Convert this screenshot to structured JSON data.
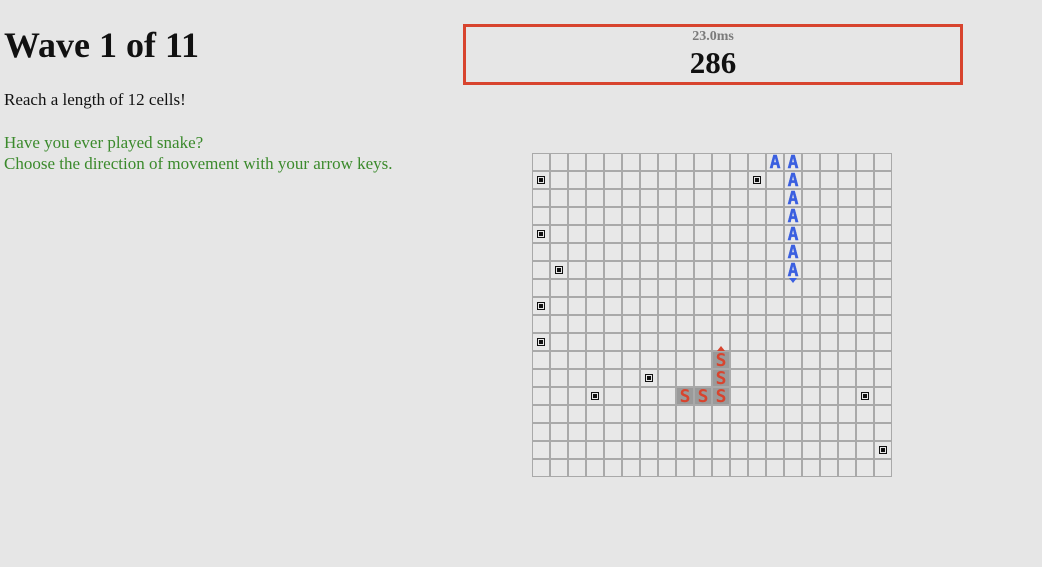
{
  "wave": {
    "title": "Wave 1 of 11"
  },
  "goal": "Reach a length of 12 cells!",
  "hint": {
    "line1": "Have you ever played snake?",
    "line2": "Choose the direction of movement with your arrow keys."
  },
  "scoreboard": {
    "timing": "23.0ms",
    "score": "286"
  },
  "board": {
    "cols": 18,
    "rows": 18,
    "mines": [
      [
        0,
        1
      ],
      [
        12,
        1
      ],
      [
        0,
        4
      ],
      [
        1,
        6
      ],
      [
        0,
        8
      ],
      [
        0,
        10
      ],
      [
        6,
        12
      ],
      [
        3,
        13
      ],
      [
        18,
        13
      ],
      [
        19,
        16
      ]
    ],
    "snake_a": {
      "letter": "A",
      "color": "#3a5fe0",
      "cells": [
        [
          13,
          0
        ],
        [
          14,
          0
        ],
        [
          14,
          1
        ],
        [
          14,
          2
        ],
        [
          14,
          3
        ],
        [
          14,
          4
        ],
        [
          14,
          5
        ],
        [
          14,
          6
        ]
      ],
      "head_direction": "down"
    },
    "snake_s": {
      "letter": "S",
      "color": "#d8442e",
      "cells": [
        [
          8,
          13
        ],
        [
          9,
          13
        ],
        [
          10,
          13
        ],
        [
          10,
          12
        ],
        [
          10,
          11
        ]
      ],
      "head_direction": "up"
    },
    "mine_icon": "mine-icon"
  }
}
